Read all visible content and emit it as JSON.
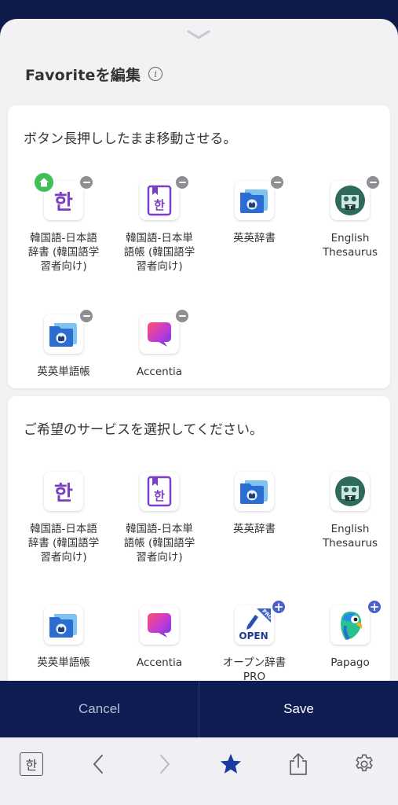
{
  "header": {
    "title": "Favoriteを編集",
    "info_icon": "info-icon"
  },
  "favorites": {
    "instruction": "ボタン長押ししたまま移動させる。",
    "apps": [
      {
        "label": "韓国語-日本語\n辞書 (韓国語学\n習者向け)",
        "icon": "korean-dict-icon",
        "home": true
      },
      {
        "label": "韓国語-日本単\n語帳 (韓国語学\n習者向け)",
        "icon": "korean-vocab-icon"
      },
      {
        "label": "英英辞書",
        "icon": "english-dict-icon"
      },
      {
        "label": "English\nThesaurus",
        "icon": "thesaurus-icon"
      },
      {
        "label": "英英単語帳",
        "icon": "english-vocab-icon"
      },
      {
        "label": "Accentia",
        "icon": "accentia-icon"
      }
    ]
  },
  "services": {
    "instruction": "ご希望のサービスを選択してください。",
    "apps": [
      {
        "label": "韓国語-日本語\n辞書 (韓国語学\n習者向け)",
        "icon": "korean-dict-icon"
      },
      {
        "label": "韓国語-日本単\n語帳 (韓国語学\n習者向け)",
        "icon": "korean-vocab-icon"
      },
      {
        "label": "英英辞書",
        "icon": "english-dict-icon"
      },
      {
        "label": "English\nThesaurus",
        "icon": "thesaurus-icon"
      },
      {
        "label": "英英単語帳",
        "icon": "english-vocab-icon"
      },
      {
        "label": "Accentia",
        "icon": "accentia-icon"
      },
      {
        "label": "オープン辞書\nPRO",
        "icon": "open-dict-pro-icon",
        "icon_text": "OPEN",
        "icon_ribbon": "PRO"
      },
      {
        "label": "Papago",
        "icon": "papago-icon"
      }
    ]
  },
  "buttons": {
    "cancel": "Cancel",
    "save": "Save"
  },
  "toolbar": {
    "dict_glyph": "한",
    "items": [
      "dictionary-icon",
      "back-icon",
      "forward-icon",
      "star-icon",
      "share-icon",
      "settings-icon"
    ]
  },
  "colors": {
    "navy": "#0f1c52",
    "accent_blue": "#1b3a9e",
    "badge_green": "#3fbf5a",
    "badge_gray": "#8e8e93",
    "badge_blue": "#4a63c8",
    "korean_purple": "#7b3fc4"
  }
}
